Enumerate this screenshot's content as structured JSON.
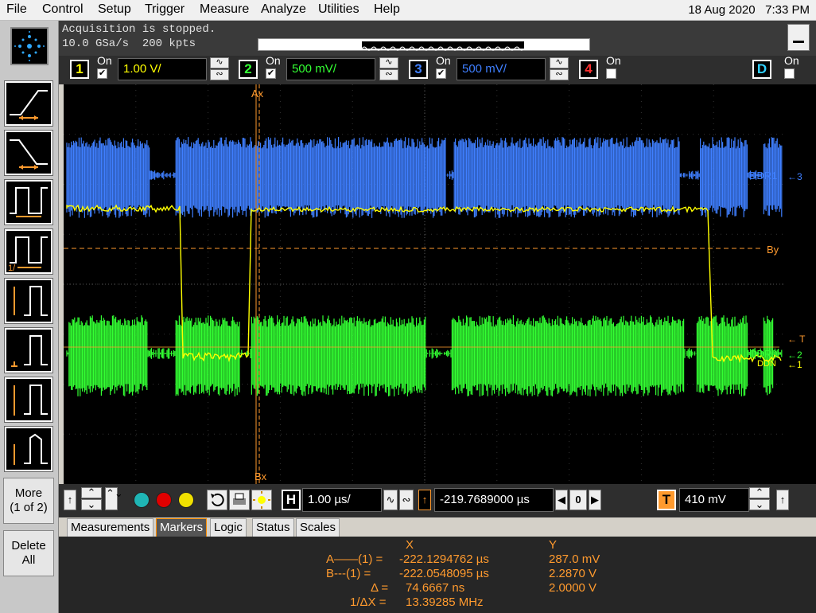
{
  "menu": [
    "File",
    "Control",
    "Setup",
    "Trigger",
    "Measure",
    "Analyze",
    "Utilities",
    "Help"
  ],
  "datetime": {
    "date": "18 Aug 2020",
    "time": "7:33 PM"
  },
  "acquisition": {
    "status": "Acquisition is stopped.",
    "rate": "10.0 GSa/s",
    "points": "200 kpts"
  },
  "channels": [
    {
      "num": "1",
      "on_label": "On",
      "on": true,
      "scale": "1.00 V/",
      "color": "#ffff00"
    },
    {
      "num": "2",
      "on_label": "On",
      "on": true,
      "scale": "500 mV/",
      "color": "#33ff33"
    },
    {
      "num": "3",
      "on_label": "On",
      "on": true,
      "scale": "500 mV/",
      "color": "#3f7fff"
    },
    {
      "num": "4",
      "on_label": "On",
      "on": false,
      "scale": "",
      "color": "#ff3030"
    }
  ],
  "digital": {
    "label": "D",
    "on_label": "On",
    "on": false
  },
  "left_buttons": {
    "more_label": "More",
    "more_page": "(1 of 2)",
    "delete_label": "Delete",
    "delete_label2": "All",
    "icons": [
      "rise-time-icon",
      "fall-time-icon",
      "period-icon",
      "frequency-icon",
      "amplitude-icon",
      "top-icon",
      "max-icon",
      "overshoot-icon"
    ]
  },
  "screen_labels": {
    "ax": "Ax",
    "bx": "Bx",
    "by": "By",
    "ddr1": "DDR1",
    "ddr0": "DDR0",
    "ddn": "DDN",
    "t": "T"
  },
  "horizontal": {
    "scale": "1.00 µs/",
    "position": "-219.7689000 µs",
    "zoom_val": "0"
  },
  "trigger": {
    "letter": "T",
    "level": "410 mV",
    "h_letter": "H"
  },
  "tabs": [
    "Measurements",
    "Markers",
    "Logic",
    "Status",
    "Scales"
  ],
  "active_tab": "Markers",
  "markers": {
    "header_x": "X",
    "header_y": "Y",
    "rows": [
      {
        "label": "A——(1) =",
        "x": "-222.1294762 µs",
        "y": "287.0 mV"
      },
      {
        "label": "B---(1) =",
        "x": "-222.0548095 µs",
        "y": "2.2870 V"
      },
      {
        "label": "Δ =",
        "x": "74.6667 ns",
        "y": "2.0000 V"
      },
      {
        "label": "1/ΔX =",
        "x": "13.39285 MHz",
        "y": ""
      }
    ]
  },
  "colors": {
    "accent": "#ff9a2e",
    "ch1": "#ffff00",
    "ch2": "#33ff33",
    "ch3": "#3f7fff",
    "ch4": "#ff3030"
  }
}
